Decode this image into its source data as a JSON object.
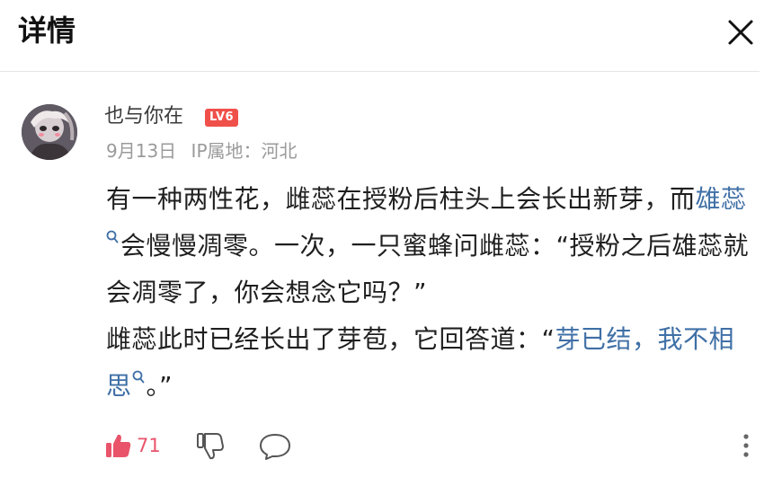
{
  "header": {
    "title": "详情",
    "close_icon": "close-icon"
  },
  "post": {
    "author": {
      "name": "也与你在",
      "level": "LV6"
    },
    "date": "9月13日",
    "ip_location": "IP属地：河北",
    "content": {
      "p1_before": "有一种两性花，雌蕊在授粉后柱头上会长出新芽，而",
      "p1_link": "雄蕊",
      "p1_after": "会慢慢凋零。一次，一只蜜蜂问雌蕊：“授粉之后雄蕊就会凋零了，你会想念它吗？”",
      "p2_before": "雌蕊此时已经长出了芽苞，它回答道：“",
      "p2_link1": "芽已结，我不相思",
      "p2_after": "。”"
    }
  },
  "actions": {
    "like_count": "71",
    "like_icon": "thumbs-up-icon",
    "dislike_icon": "thumbs-down-icon",
    "comment_icon": "comment-bubble-icon",
    "more_icon": "more-vertical-icon"
  },
  "colors": {
    "link": "#3f6fa6",
    "like": "#e9546b",
    "badge": "#f0504a",
    "meta_text": "#9a9a9a"
  }
}
